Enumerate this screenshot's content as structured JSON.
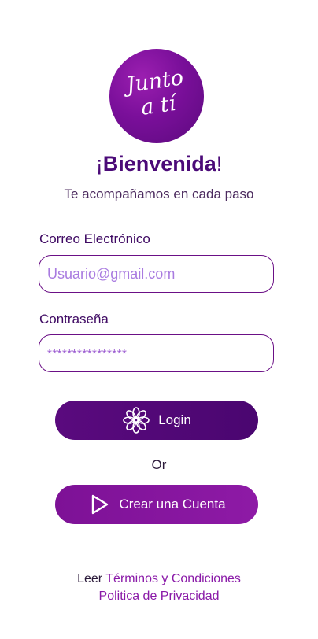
{
  "logo": {
    "line1": "Junto",
    "line2": "a tí"
  },
  "welcome": {
    "excl_open": "¡",
    "word": "Bienvenida",
    "excl_close": "!"
  },
  "subtitle": "Te acompañamos en cada paso",
  "email": {
    "label": "Correo Electrónico",
    "placeholder": "Usuario@gmail.com"
  },
  "password": {
    "label": "Contraseña",
    "value": "****************"
  },
  "login_button": {
    "label": "Login",
    "icon": "flower-icon"
  },
  "or_text": "Or",
  "create_button": {
    "label": "Crear una Cuenta",
    "icon": "play-icon"
  },
  "footer": {
    "read_prefix": "Leer",
    "terms_link": "Términos y Condiciones",
    "privacy_link": "Politica de Privacidad"
  },
  "colors": {
    "primary_dark": "#4b0a78",
    "primary": "#7d1196",
    "link": "#8a1aa8",
    "placeholder": "#a97be0"
  }
}
